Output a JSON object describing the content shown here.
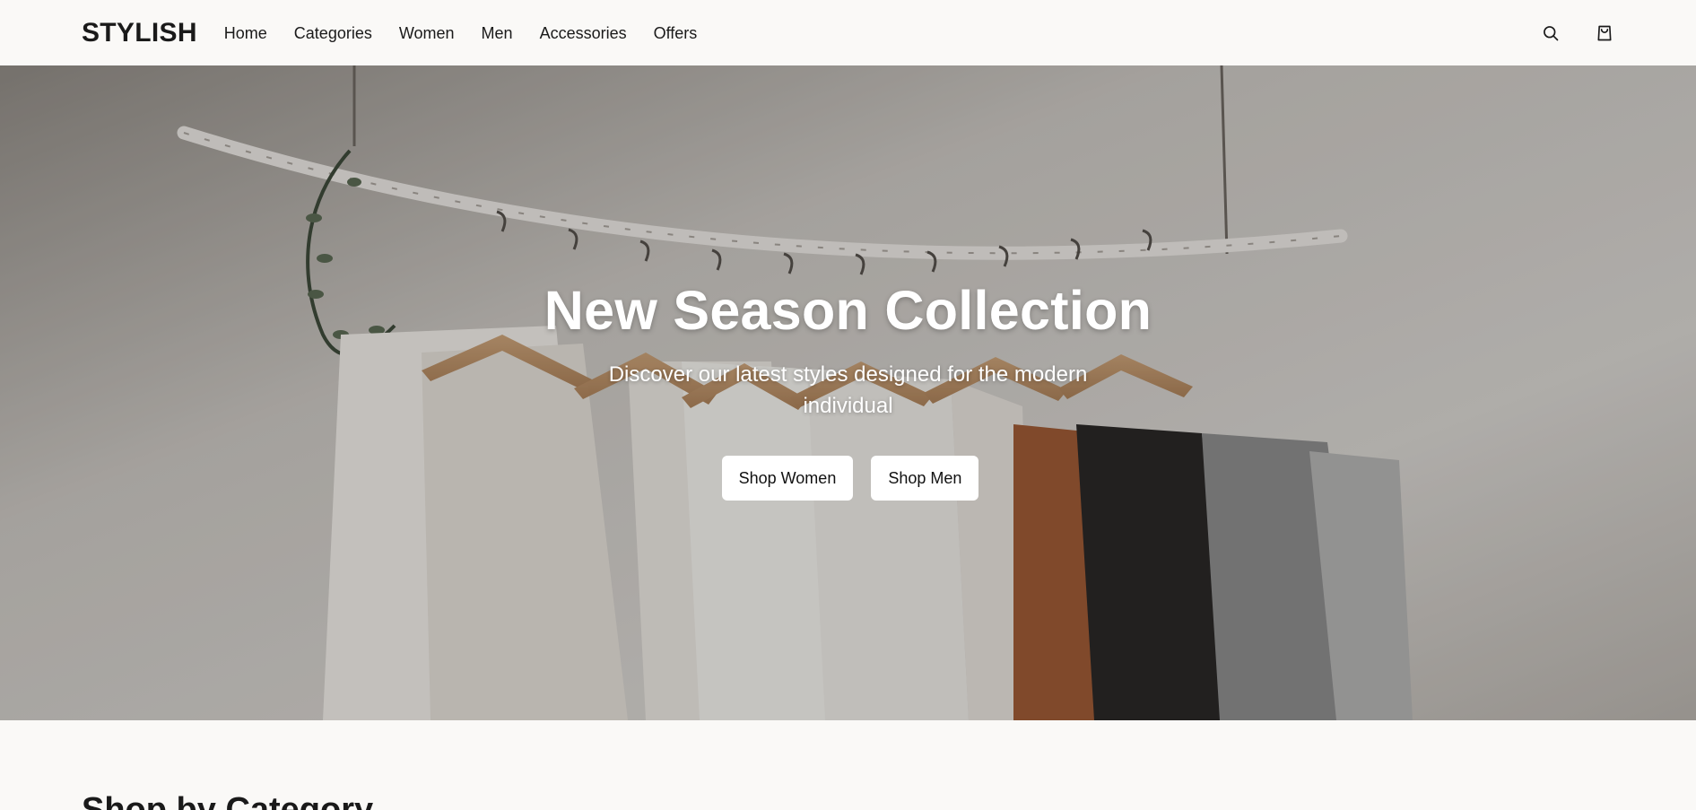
{
  "brand": {
    "logo": "STYLISH"
  },
  "nav": {
    "items": [
      {
        "label": "Home"
      },
      {
        "label": "Categories"
      },
      {
        "label": "Women"
      },
      {
        "label": "Men"
      },
      {
        "label": "Accessories"
      },
      {
        "label": "Offers"
      }
    ]
  },
  "header_icons": {
    "search": "search-icon",
    "cart": "shopping-bag-icon"
  },
  "hero": {
    "title": "New Season Collection",
    "subtitle": "Discover our latest styles designed for the modern individual",
    "buttons": [
      {
        "label": "Shop Women"
      },
      {
        "label": "Shop Men"
      }
    ]
  },
  "sections": {
    "category_title": "Shop by Category"
  },
  "colors": {
    "page_bg": "#faf9f7",
    "text": "#1a1a1a",
    "hero_button_bg": "#ffffff"
  }
}
